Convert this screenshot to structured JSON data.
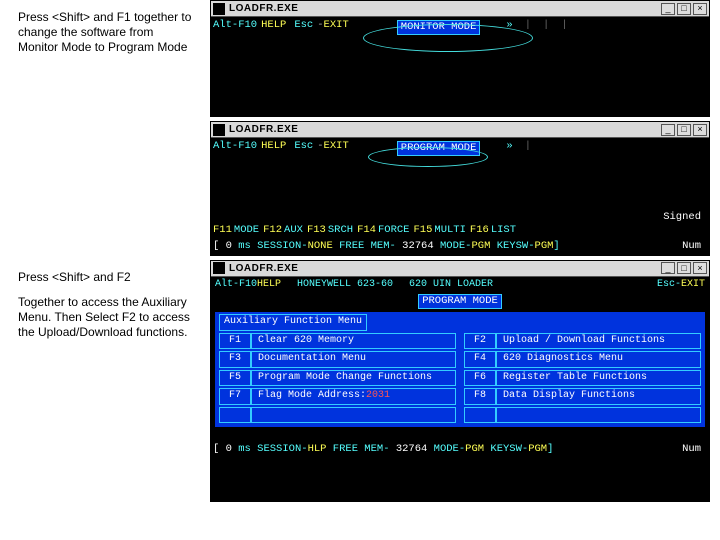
{
  "instructions": {
    "p1": "Press <Shift> and F1 together to change the software from Monitor Mode to Program Mode",
    "p2": "Press <Shift> and F2",
    "p3": "Together to access the Auxiliary Menu.  Then Select F2 to access the Upload/Download functions."
  },
  "common": {
    "window_title": "LOADFR.EXE",
    "help_key": "Alt-F10",
    "help_label": "HELP",
    "esc_key": "Esc",
    "exit_label": "EXIT",
    "arrows": "»",
    "min": "_",
    "max": "□",
    "close": "×"
  },
  "win1": {
    "mode": "MONITOR MODE"
  },
  "win2": {
    "mode": "PROGRAM MODE",
    "signed": "Signed",
    "fkeys": [
      {
        "k": "F11",
        "l": "MODE"
      },
      {
        "k": "F12",
        "l": "AUX"
      },
      {
        "k": "F13",
        "l": "SRCH"
      },
      {
        "k": "F14",
        "l": "FORCE"
      },
      {
        "k": "F15",
        "l": "MULTI"
      },
      {
        "k": "F16",
        "l": "LIST"
      }
    ],
    "status": {
      "addr": "0",
      "ms": "ms",
      "session": "SESSION-",
      "session_val": "NONE",
      "mem": "FREE MEM-",
      "mem_val": "32764",
      "mode": "MODE-",
      "mode_val": "PGM",
      "keysw": "KEYSW-",
      "keysw_val": "PGM",
      "end": "]",
      "num": "Num"
    }
  },
  "win3": {
    "top": {
      "brand": "HONEYWELL 623-60",
      "device": "620   UIN   LOADER",
      "esc": "Esc-",
      "exit": "EXIT"
    },
    "mode": "PROGRAM MODE",
    "aux_title": "Auxiliary Function Menu",
    "items": [
      {
        "k": "F1",
        "l": "Clear 620 Memory"
      },
      {
        "k": "F2",
        "l": "Upload / Download Functions"
      },
      {
        "k": "F3",
        "l": "Documentation Menu"
      },
      {
        "k": "F4",
        "l": "620 Diagnostics Menu"
      },
      {
        "k": "F5",
        "l": "Program Mode Change Functions"
      },
      {
        "k": "F6",
        "l": "Register Table Functions"
      },
      {
        "k": "F7",
        "l": "Flag Mode Address:",
        "addr": "2031"
      },
      {
        "k": "F8",
        "l": "Data Display Functions"
      }
    ],
    "status": {
      "addr": "0",
      "ms": "ms",
      "session": "SESSION-",
      "session_val": "HLP",
      "mem": "FREE MEM-",
      "mem_val": "32764",
      "mode": "MODE-",
      "mode_val": "PGM",
      "keysw": "KEYSW-",
      "keysw_val": "PGM",
      "end": "]",
      "num": "Num"
    }
  }
}
